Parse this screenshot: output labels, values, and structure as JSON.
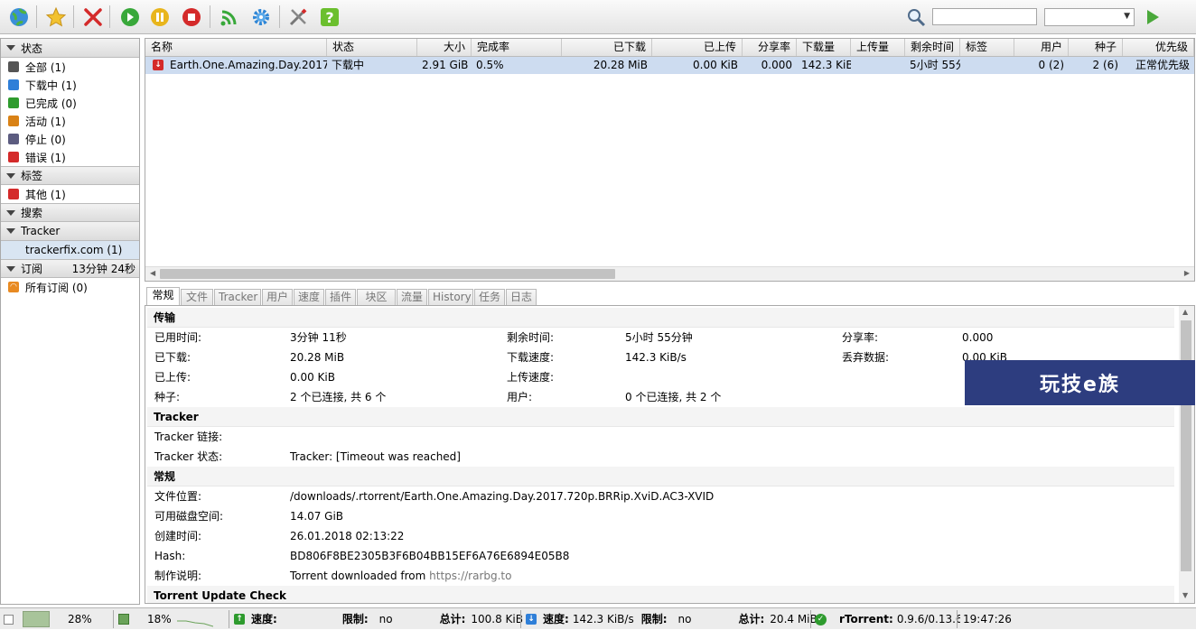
{
  "toolbar": {
    "buttons": [
      {
        "name": "globe-icon"
      },
      {
        "name": "star-icon"
      },
      {
        "name": "remove-icon"
      },
      {
        "name": "start-icon"
      },
      {
        "name": "pause-icon"
      },
      {
        "name": "stop-icon"
      },
      {
        "name": "rss-icon"
      },
      {
        "name": "settings-gear-icon"
      },
      {
        "name": "tools-icon"
      },
      {
        "name": "help-icon"
      }
    ],
    "search_value": "",
    "filter_value": ""
  },
  "sidebar": {
    "status_header": "状态",
    "status_items": [
      {
        "label": "全部 (1)",
        "icon": "all-icon",
        "color": "#555555"
      },
      {
        "label": "下载中 (1)",
        "icon": "downloading-icon",
        "color": "#2f7fd8"
      },
      {
        "label": "已完成 (0)",
        "icon": "completed-icon",
        "color": "#2e9b2e"
      },
      {
        "label": "活动 (1)",
        "icon": "active-icon",
        "color": "#d98216"
      },
      {
        "label": "停止 (0)",
        "icon": "stopped-icon",
        "color": "#5c5c80"
      },
      {
        "label": "错误 (1)",
        "icon": "error-icon",
        "color": "#d42a2a"
      }
    ],
    "labels_header": "标签",
    "label_items": [
      {
        "label": "其他 (1)",
        "icon": "other-icon",
        "color": "#d42a2a"
      }
    ],
    "search_header": "搜索",
    "tracker_header": "Tracker",
    "tracker_items": [
      {
        "label": "trackerfix.com (1)"
      }
    ],
    "feeds_header": "订阅",
    "feeds_timer": "13分钟 24秒",
    "feed_items": [
      {
        "label": "所有订阅 (0)",
        "icon": "rss-feed-icon",
        "color": "#e88a22"
      }
    ]
  },
  "torrent_table": {
    "headers": [
      "名称",
      "状态",
      "大小",
      "完成率",
      "已下载",
      "已上传",
      "分享率",
      "下载量",
      "上传量",
      "剩余时间",
      "标签",
      "用户",
      "种子",
      "优先级"
    ],
    "rows": [
      {
        "name": "Earth.One.Amazing.Day.2017.",
        "status": "下载中",
        "size": "2.91 GiB",
        "done": "0.5%",
        "downloaded": "20.28 MiB",
        "uploaded": "0.00 KiB",
        "ratio": "0.000",
        "down_speed": "142.3 KiB",
        "up_speed": "",
        "eta": "5小时 55分",
        "label": "",
        "peers": "0 (2)",
        "seeds": "2 (6)",
        "priority": "正常优先级"
      }
    ]
  },
  "tabs": [
    "常规",
    "文件",
    "Tracker",
    "用户",
    "速度",
    "插件",
    "块区块",
    "流量",
    "History",
    "任务",
    "日志"
  ],
  "details": {
    "transfer_title": "传输",
    "elapsed_label": "已用时间:",
    "elapsed": "3分钟 11秒",
    "remaining_label": "剩余时间:",
    "remaining": "5小时 55分钟",
    "ratio_label": "分享率:",
    "ratio": "0.000",
    "downloaded_label": "已下载:",
    "downloaded": "20.28 MiB",
    "dlspeed_label": "下载速度:",
    "dlspeed": "142.3 KiB/s",
    "wasted_label": "丢弃数据:",
    "wasted": "0.00 KiB",
    "uploaded_label": "已上传:",
    "uploaded": "0.00 KiB",
    "ulspeed_label": "上传速度:",
    "ulspeed": "",
    "seeds_label": "种子:",
    "seeds": "2 个已连接, 共 6 个",
    "peers_label": "用户:",
    "peers": "0 个已连接, 共 2 个",
    "tracker_title": "Tracker",
    "tracker_link_label": "Tracker 链接:",
    "tracker_link": "",
    "tracker_status_label": "Tracker 状态:",
    "tracker_status": "Tracker: [Timeout was reached]",
    "general_title": "常规",
    "location_label": "文件位置:",
    "location": "/downloads/.rtorrent/Earth.One.Amazing.Day.2017.720p.BRRip.XviD.AC3-XVID",
    "free_space_label": "可用磁盘空间:",
    "free_space": "14.07 GiB",
    "created_label": "创建时间:",
    "created": "26.01.2018 02:13:22",
    "hash_label": "Hash:",
    "hash": "BD806F8BE2305B3F6B04BB15EF6A76E6894E05B8",
    "comment_label": "制作说明:",
    "comment_prefix": "Torrent downloaded from",
    "comment_link": "https://rarbg.to",
    "update_check_title": "Torrent Update Check"
  },
  "watermark": "玩技e族",
  "statusbar": {
    "disk_percent": "28%",
    "cpu_percent": "18%",
    "up_speed_label": "速度:",
    "up_speed": "",
    "up_limit_label": "限制:",
    "up_limit": "no",
    "up_total_label": "总计:",
    "up_total": "100.8 KiB",
    "down_speed_label": "速度:",
    "down_speed": "142.3 KiB/s",
    "down_limit_label": "限制:",
    "down_limit": "no",
    "down_total_label": "总计:",
    "down_total": "20.4 MiB",
    "version_label": "rTorrent:",
    "version": "0.9.6/0.13.6",
    "time": "19:47:26"
  },
  "colors": {
    "selection": "#cddcf0",
    "sidebar_selection": "#d9e5f2",
    "watermark_bg": "#2d3d7f"
  }
}
